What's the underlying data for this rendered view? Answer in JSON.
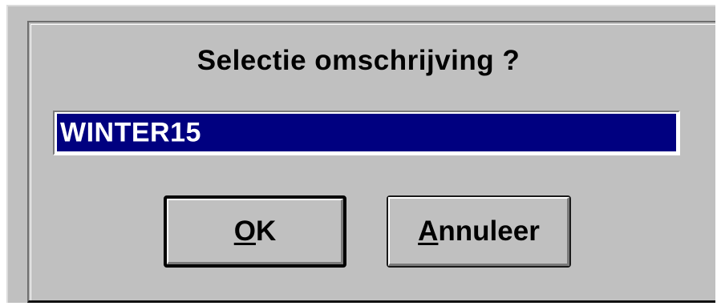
{
  "dialog": {
    "prompt": "Selectie omschrijving ?",
    "field_value": "WINTER15",
    "ok_button": {
      "accelerator": "O",
      "rest": "K"
    },
    "cancel_button": {
      "accelerator": "A",
      "rest": "nnuleer"
    }
  },
  "colors": {
    "dialog_face": "#c0c0c0",
    "selection": "#000080",
    "selection_text": "#ffffff"
  }
}
